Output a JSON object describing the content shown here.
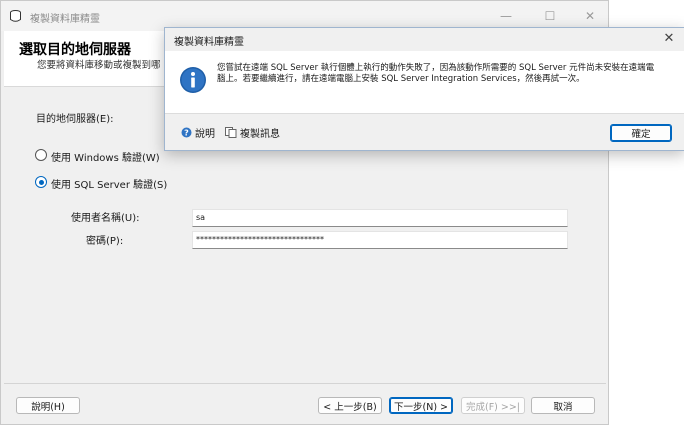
{
  "main_window": {
    "title": "複製資料庫精靈",
    "controls": {
      "minimize": "—",
      "maximize": "☐",
      "close": "✕"
    },
    "header": {
      "title": "選取目的地伺服器",
      "subtitle": "您要將資料庫移動或複製到哪"
    },
    "form": {
      "dest_server_label": "目的地伺服器(E):",
      "auth_windows_label": "使用 Windows 驗證(W)",
      "auth_sql_label": "使用 SQL Server 驗證(S)",
      "auth_selected": "sql",
      "username_label": "使用者名稱(U):",
      "username_value": "sa",
      "password_label": "密碼(P):",
      "password_value": "********************************"
    },
    "footer": {
      "help": "說明(H)",
      "back": "< 上一步(B)",
      "next": "下一步(N) >",
      "finish": "完成(F) >>|",
      "cancel": "取消"
    }
  },
  "dialog": {
    "title": "複製資料庫精靈",
    "close": "✕",
    "message": "您嘗試在遠端 SQL Server 執行個體上執行的動作失敗了，因為該動作所需要的 SQL Server 元件尚未安裝在遠端電腦上。若要繼續進行，請在遠端電腦上安裝 SQL Server Integration Services，然後再試一次。",
    "help_link": "說明",
    "copy_link": "複製訊息",
    "ok": "確定"
  },
  "colors": {
    "accent": "#0067c0",
    "info_icon": "#1f5fa8"
  }
}
